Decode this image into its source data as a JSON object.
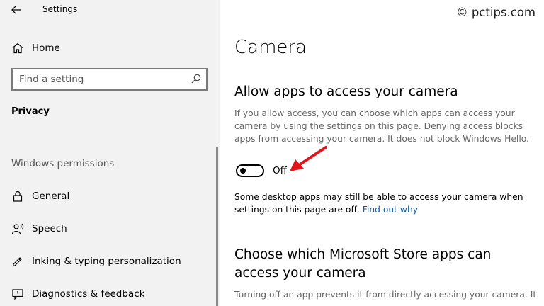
{
  "window": {
    "title": "Settings"
  },
  "sidebar": {
    "home_label": "Home",
    "search": {
      "placeholder": "Find a setting"
    },
    "section_privacy": "Privacy",
    "section_permissions": "Windows permissions",
    "items": [
      {
        "label": "General",
        "icon": "lock-icon"
      },
      {
        "label": "Speech",
        "icon": "speech-icon"
      },
      {
        "label": "Inking & typing personalization",
        "icon": "pen-icon"
      },
      {
        "label": "Diagnostics & feedback",
        "icon": "feedback-icon"
      }
    ]
  },
  "watermark": "© pctips.com",
  "main": {
    "title": "Camera",
    "allow_heading": "Allow apps to access your camera",
    "allow_description": "If you allow access, you can choose which apps can access your camera by using the settings on this page. Denying access blocks apps from accessing your camera. It does not block Windows Hello.",
    "toggle": {
      "state": "Off",
      "on": false
    },
    "desktop_note": "Some desktop apps may still be able to access your camera when settings on this page are off.",
    "find_out_link": "Find out why",
    "store_heading": "Choose which Microsoft Store apps can access your camera",
    "store_description": "Turning off an app prevents it from directly accessing your camera. It"
  },
  "colors": {
    "sidebar_bg": "#f2f2f2",
    "link": "#0a5fa8",
    "annotation_arrow": "#e0161b"
  }
}
